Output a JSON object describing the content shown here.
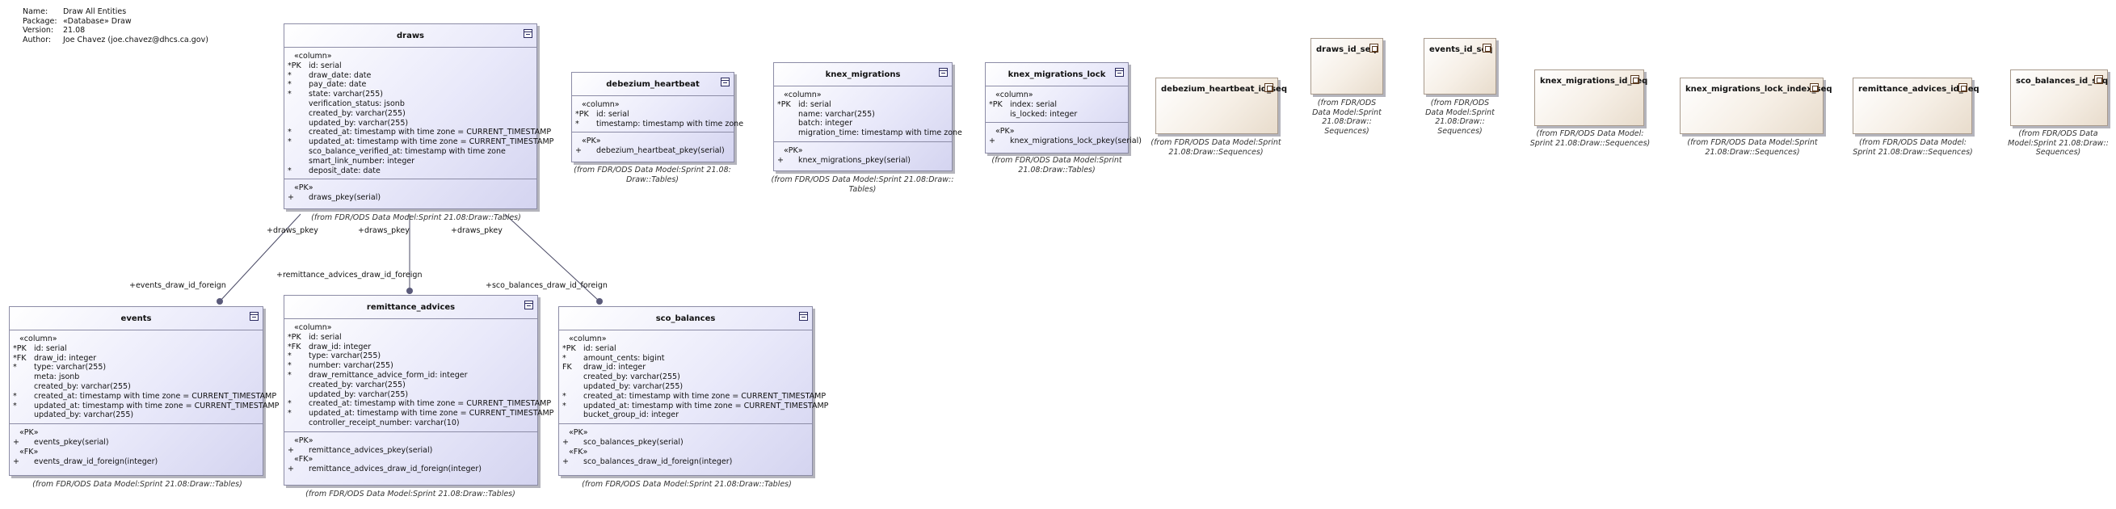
{
  "meta": [
    {
      "key": "Name:",
      "value": "Draw All Entities"
    },
    {
      "key": "Package:",
      "value": "«Database» Draw"
    },
    {
      "key": "Version:",
      "value": "21.08"
    },
    {
      "key": "Author:",
      "value": "Joe Chavez (joe.chavez@dhcs.ca.gov)"
    }
  ],
  "tables": {
    "draws": {
      "title": "draws",
      "column_stereo": "«column»",
      "columns": [
        {
          "mk": "*PK",
          "text": "id: serial"
        },
        {
          "mk": "*",
          "text": "draw_date: date"
        },
        {
          "mk": "*",
          "text": "pay_date: date"
        },
        {
          "mk": "*",
          "text": "state: varchar(255)"
        },
        {
          "mk": "",
          "text": "verification_status: jsonb"
        },
        {
          "mk": "",
          "text": "created_by: varchar(255)"
        },
        {
          "mk": "",
          "text": "updated_by: varchar(255)"
        },
        {
          "mk": "*",
          "text": "created_at: timestamp with time zone = CURRENT_TIMESTAMP"
        },
        {
          "mk": "*",
          "text": "updated_at: timestamp with time zone = CURRENT_TIMESTAMP"
        },
        {
          "mk": "",
          "text": "sco_balance_verified_at: timestamp with time zone"
        },
        {
          "mk": "",
          "text": "smart_link_number: integer"
        },
        {
          "mk": "*",
          "text": "deposit_date: date"
        }
      ],
      "pk_stereo": "«PK»",
      "pk": [
        {
          "mk": "+",
          "text": "draws_pkey(serial)"
        }
      ],
      "note": "(from FDR/ODS Data Model:Sprint 21.08:Draw::Tables)"
    },
    "debezium_heartbeat": {
      "title": "debezium_heartbeat",
      "column_stereo": "«column»",
      "columns": [
        {
          "mk": "*PK",
          "text": "id: serial"
        },
        {
          "mk": "*",
          "text": "timestamp: timestamp with time zone"
        }
      ],
      "pk_stereo": "«PK»",
      "pk": [
        {
          "mk": "+",
          "text": "debezium_heartbeat_pkey(serial)"
        }
      ],
      "note": "(from FDR/ODS Data Model:Sprint 21.08:\nDraw::Tables)"
    },
    "knex_migrations": {
      "title": "knex_migrations",
      "column_stereo": "«column»",
      "columns": [
        {
          "mk": "*PK",
          "text": "id: serial"
        },
        {
          "mk": "",
          "text": "name: varchar(255)"
        },
        {
          "mk": "",
          "text": "batch: integer"
        },
        {
          "mk": "",
          "text": "migration_time: timestamp with time zone"
        }
      ],
      "pk_stereo": "«PK»",
      "pk": [
        {
          "mk": "+",
          "text": "knex_migrations_pkey(serial)"
        }
      ],
      "note": "(from FDR/ODS Data Model:Sprint 21.08:Draw::\nTables)"
    },
    "knex_migrations_lock": {
      "title": "knex_migrations_lock",
      "column_stereo": "«column»",
      "columns": [
        {
          "mk": "*PK",
          "text": "index: serial"
        },
        {
          "mk": "",
          "text": "is_locked: integer"
        }
      ],
      "pk_stereo": "«PK»",
      "pk": [
        {
          "mk": "+",
          "text": "knex_migrations_lock_pkey(serial)"
        }
      ],
      "note": "(from FDR/ODS Data Model:Sprint\n21.08:Draw::Tables)"
    },
    "events": {
      "title": "events",
      "column_stereo": "«column»",
      "columns": [
        {
          "mk": "*PK",
          "text": "id: serial"
        },
        {
          "mk": "*FK",
          "text": "draw_id: integer"
        },
        {
          "mk": "*",
          "text": "type: varchar(255)"
        },
        {
          "mk": "",
          "text": "meta: jsonb"
        },
        {
          "mk": "",
          "text": "created_by: varchar(255)"
        },
        {
          "mk": "*",
          "text": "created_at: timestamp with time zone = CURRENT_TIMESTAMP"
        },
        {
          "mk": "*",
          "text": "updated_at: timestamp with time zone = CURRENT_TIMESTAMP"
        },
        {
          "mk": "",
          "text": "updated_by: varchar(255)"
        }
      ],
      "pk_stereo": "«PK»",
      "pk": [
        {
          "mk": "+",
          "text": "events_pkey(serial)"
        }
      ],
      "fk_stereo": "«FK»",
      "fk": [
        {
          "mk": "+",
          "text": "events_draw_id_foreign(integer)"
        }
      ],
      "note": "(from FDR/ODS Data Model:Sprint 21.08:Draw::Tables)"
    },
    "remittance_advices": {
      "title": "remittance_advices",
      "column_stereo": "«column»",
      "columns": [
        {
          "mk": "*PK",
          "text": "id: serial"
        },
        {
          "mk": "*FK",
          "text": "draw_id: integer"
        },
        {
          "mk": "*",
          "text": "type: varchar(255)"
        },
        {
          "mk": "*",
          "text": "number: varchar(255)"
        },
        {
          "mk": "*",
          "text": "draw_remittance_advice_form_id: integer"
        },
        {
          "mk": "",
          "text": "created_by: varchar(255)"
        },
        {
          "mk": "",
          "text": "updated_by: varchar(255)"
        },
        {
          "mk": "*",
          "text": "created_at: timestamp with time zone = CURRENT_TIMESTAMP"
        },
        {
          "mk": "*",
          "text": "updated_at: timestamp with time zone = CURRENT_TIMESTAMP"
        },
        {
          "mk": "",
          "text": "controller_receipt_number: varchar(10)"
        }
      ],
      "pk_stereo": "«PK»",
      "pk": [
        {
          "mk": "+",
          "text": "remittance_advices_pkey(serial)"
        }
      ],
      "fk_stereo": "«FK»",
      "fk": [
        {
          "mk": "+",
          "text": "remittance_advices_draw_id_foreign(integer)"
        }
      ],
      "note": "(from FDR/ODS Data Model:Sprint 21.08:Draw::Tables)"
    },
    "sco_balances": {
      "title": "sco_balances",
      "column_stereo": "«column»",
      "columns": [
        {
          "mk": "*PK",
          "text": "id: serial"
        },
        {
          "mk": "*",
          "text": "amount_cents: bigint"
        },
        {
          "mk": "FK",
          "text": "draw_id: integer"
        },
        {
          "mk": "",
          "text": "created_by: varchar(255)"
        },
        {
          "mk": "",
          "text": "updated_by: varchar(255)"
        },
        {
          "mk": "*",
          "text": "created_at: timestamp with time zone = CURRENT_TIMESTAMP"
        },
        {
          "mk": "*",
          "text": "updated_at: timestamp with time zone = CURRENT_TIMESTAMP"
        },
        {
          "mk": "",
          "text": "bucket_group_id: integer"
        }
      ],
      "pk_stereo": "«PK»",
      "pk": [
        {
          "mk": "+",
          "text": "sco_balances_pkey(serial)"
        }
      ],
      "fk_stereo": "«FK»",
      "fk": [
        {
          "mk": "+",
          "text": "sco_balances_draw_id_foreign(integer)"
        }
      ],
      "note": "(from FDR/ODS Data Model:Sprint 21.08:Draw::Tables)"
    }
  },
  "sequences": {
    "debezium_heartbeat_id_seq": {
      "title": "debezium_heartbeat_id_seq",
      "note": "(from FDR/ODS Data Model:Sprint\n21.08:Draw::Sequences)"
    },
    "draws_id_seq": {
      "title": "draws_id_seq",
      "note": "(from FDR/ODS\nData Model:Sprint\n21.08:Draw::\nSequences)"
    },
    "events_id_seq": {
      "title": "events_id_seq",
      "note": "(from FDR/ODS\nData Model:Sprint\n21.08:Draw::\nSequences)"
    },
    "knex_migrations_id_seq": {
      "title": "knex_migrations_id_seq",
      "note": "(from FDR/ODS Data Model:\nSprint 21.08:Draw::Sequences)"
    },
    "knex_migrations_lock_index_seq": {
      "title": "knex_migrations_lock_index_seq",
      "note": "(from FDR/ODS Data Model:Sprint\n21.08:Draw::Sequences)"
    },
    "remittance_advices_id_seq": {
      "title": "remittance_advices_id_seq",
      "note": "(from FDR/ODS Data Model:\nSprint 21.08:Draw::Sequences)"
    },
    "sco_balances_id_seq": {
      "title": "sco_balances_id_seq",
      "note": "(from FDR/ODS Data\nModel:Sprint 21.08:Draw::\nSequences)"
    }
  },
  "links": {
    "events": {
      "source": "+draws_pkey",
      "target": "+events_draw_id_foreign"
    },
    "remittance": {
      "source": "+draws_pkey",
      "target": "+remittance_advices_draw_id_foreign"
    },
    "sco": {
      "source": "+draws_pkey",
      "target": "+sco_balances_draw_id_foreign"
    }
  }
}
